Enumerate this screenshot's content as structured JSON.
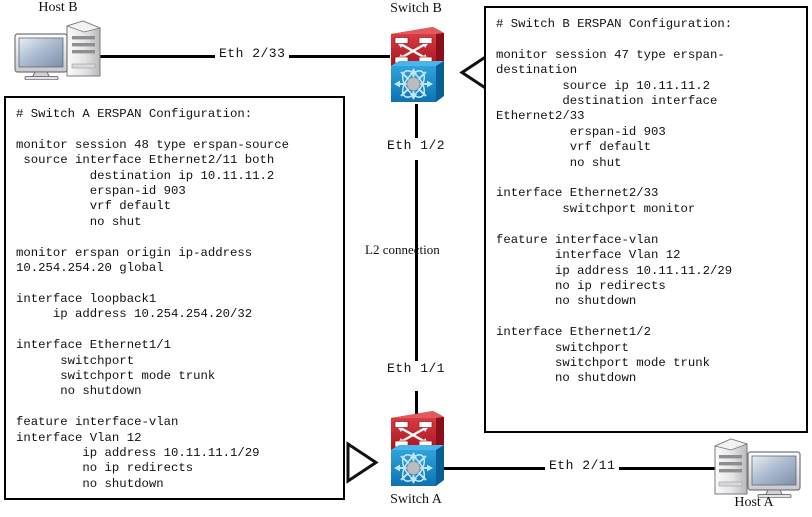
{
  "nodes": {
    "host_b": {
      "label": "Host B"
    },
    "host_a": {
      "label": "Host A"
    },
    "switch_b": {
      "label": "Switch B"
    },
    "switch_a": {
      "label": "Switch A"
    }
  },
  "links": {
    "host_b_to_switch_b": {
      "label": "Eth 2/33"
    },
    "switch_b_downlink": {
      "label": "Eth 1/2"
    },
    "trunk": {
      "label": "L2 connection"
    },
    "switch_a_uplink": {
      "label": "Eth 1/1"
    },
    "switch_a_to_host_a": {
      "label": "Eth 2/11"
    }
  },
  "config_switch_a": {
    "text": "# Switch A ERSPAN Configuration:\n\nmonitor session 48 type erspan-source\n source interface Ethernet2/11 both\n          destination ip 10.11.11.2\n          erspan-id 903\n          vrf default\n          no shut\n\nmonitor erspan origin ip-address\n10.254.254.20 global\n\ninterface loopback1\n     ip address 10.254.254.20/32\n\ninterface Ethernet1/1\n      switchport\n      switchport mode trunk\n      no shutdown\n\nfeature interface-vlan\ninterface Vlan 12\n         ip address 10.11.11.1/29\n         no ip redirects\n         no shutdown"
  },
  "config_switch_b": {
    "text": "# Switch B ERSPAN Configuration:\n\nmonitor session 47 type erspan-\ndestination\n         source ip 10.11.11.2\n         destination interface\nEthernet2/33\n          erspan-id 903\n          vrf default\n          no shut\n\ninterface Ethernet2/33\n         switchport monitor\n\nfeature interface-vlan\n        interface Vlan 12\n        ip address 10.11.11.2/29\n        no ip redirects\n        no shutdown\n\ninterface Ethernet1/2\n        switchport\n        switchport mode trunk\n        no shutdown"
  },
  "colors": {
    "switch_top": "#c0202a",
    "switch_bottom": "#1a8ecb",
    "line": "#000000",
    "box_border": "#000000"
  },
  "icons": {
    "switch": "multilayer-switch-icon",
    "host": "desktop-computer-icon",
    "arrow_left": "triangle-left-icon",
    "arrow_right": "triangle-right-icon"
  }
}
